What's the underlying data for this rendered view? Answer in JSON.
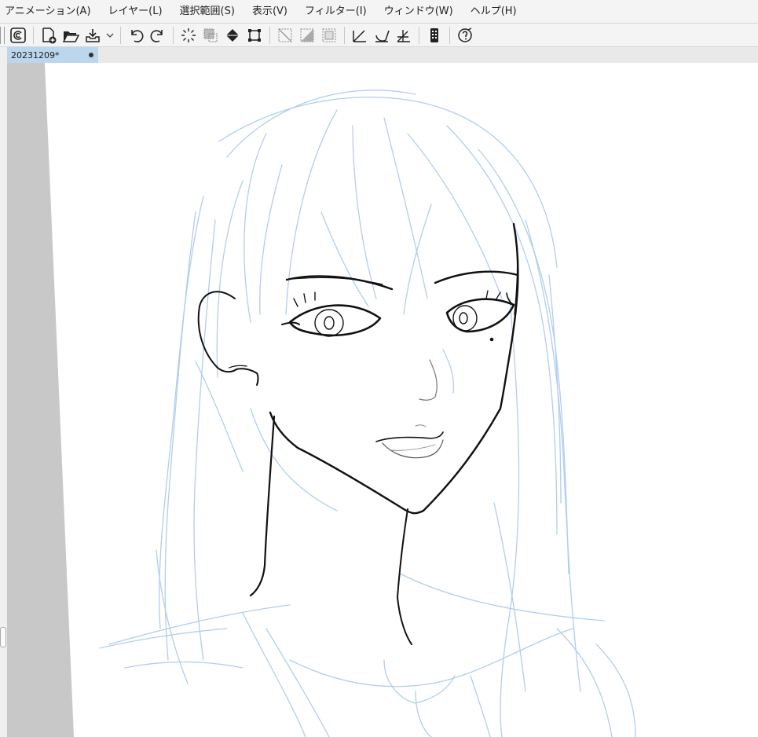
{
  "menu": [
    {
      "label": "アニメーション(A)",
      "name": "menu-animation"
    },
    {
      "label": "レイヤー(L)",
      "name": "menu-layer"
    },
    {
      "label": "選択範囲(S)",
      "name": "menu-selection"
    },
    {
      "label": "表示(V)",
      "name": "menu-view"
    },
    {
      "label": "フィルター(I)",
      "name": "menu-filter"
    },
    {
      "label": "ウィンドウ(W)",
      "name": "menu-window"
    },
    {
      "label": "ヘルプ(H)",
      "name": "menu-help"
    }
  ],
  "toolbar": {
    "icons": [
      "clip-studio-icon",
      "new-canvas-icon",
      "open-folder-icon",
      "save-icon",
      "chevron-down-icon",
      "undo-icon",
      "redo-icon",
      "clear-icon",
      "fill-selection-icon",
      "fill-icon",
      "transform-icon",
      "deselect-icon",
      "invert-selection-icon",
      "show-selection-border-icon",
      "snap-ruler-icon",
      "snap-special-ruler-icon",
      "snap-grid-icon",
      "smartphone-icon",
      "help-icon"
    ]
  },
  "document": {
    "tab_label": "20231209*"
  },
  "colors": {
    "accent_tab": "#bcd6ee",
    "sketch_blue": "#a9c8ee",
    "lineart": "#111111",
    "pasteboard": "#c8c8c8"
  }
}
